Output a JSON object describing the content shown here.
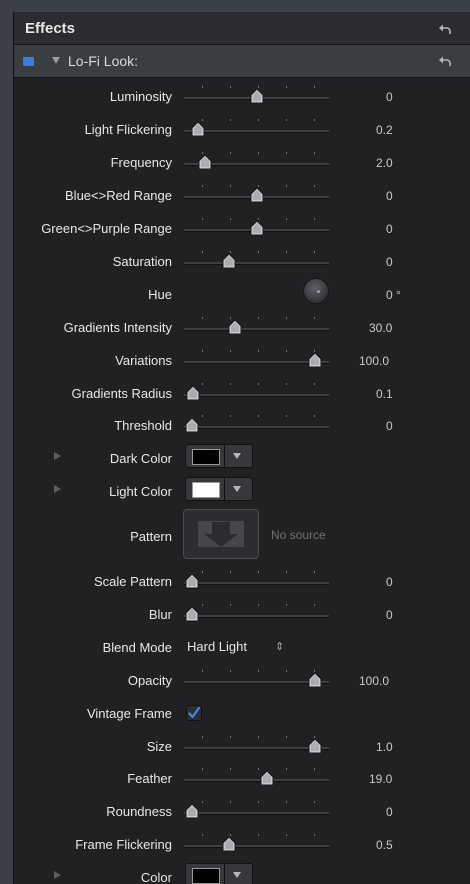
{
  "panel": {
    "title": "Effects",
    "reset_icon": "reset-arrow-icon"
  },
  "effect": {
    "name": "Lo-Fi Look:",
    "enabled": true,
    "enabled_color": "#3b7ce8"
  },
  "params": {
    "luminosity": {
      "label": "Luminosity",
      "value": "0",
      "position": 0.5
    },
    "light_flickering": {
      "label": "Light Flickering",
      "value": "0.2",
      "position": 0.05
    },
    "frequency": {
      "label": "Frequency",
      "value": "2.0",
      "position": 0.1
    },
    "blue_red": {
      "label": "Blue<>Red Range",
      "value": "0",
      "position": 0.5
    },
    "green_purple": {
      "label": "Green<>Purple Range",
      "value": "0",
      "position": 0.5
    },
    "saturation": {
      "label": "Saturation",
      "value": "0",
      "position": 0.29
    },
    "hue": {
      "label": "Hue",
      "value": "0 °"
    },
    "gradients_intensity": {
      "label": "Gradients Intensity",
      "value": "30.0",
      "position": 0.33
    },
    "variations": {
      "label": "Variations",
      "value": "100.0",
      "position": 0.95
    },
    "gradients_radius": {
      "label": "Gradients Radius",
      "value": "0.1",
      "position": 0.01
    },
    "threshold": {
      "label": "Threshold",
      "value": "0",
      "position": 0.0
    },
    "dark_color": {
      "label": "Dark Color",
      "swatch": "#000000"
    },
    "light_color": {
      "label": "Light Color",
      "swatch": "#ffffff"
    },
    "pattern": {
      "label": "Pattern",
      "empty_text": "No source"
    },
    "scale_pattern": {
      "label": "Scale Pattern",
      "value": "0",
      "position": 0.0
    },
    "blur": {
      "label": "Blur",
      "value": "0",
      "position": 0.0
    },
    "blend_mode": {
      "label": "Blend Mode",
      "value": "Hard Light"
    },
    "opacity": {
      "label": "Opacity",
      "value": "100.0",
      "position": 0.95
    },
    "vintage_frame": {
      "label": "Vintage Frame",
      "checked": true
    },
    "size": {
      "label": "Size",
      "value": "1.0",
      "position": 0.95
    },
    "feather": {
      "label": "Feather",
      "value": "19.0",
      "position": 0.58
    },
    "roundness": {
      "label": "Roundness",
      "value": "0",
      "position": 0.0
    },
    "frame_flickering": {
      "label": "Frame Flickering",
      "value": "0.5",
      "position": 0.29
    },
    "color": {
      "label": "Color",
      "swatch": "#000000"
    }
  }
}
